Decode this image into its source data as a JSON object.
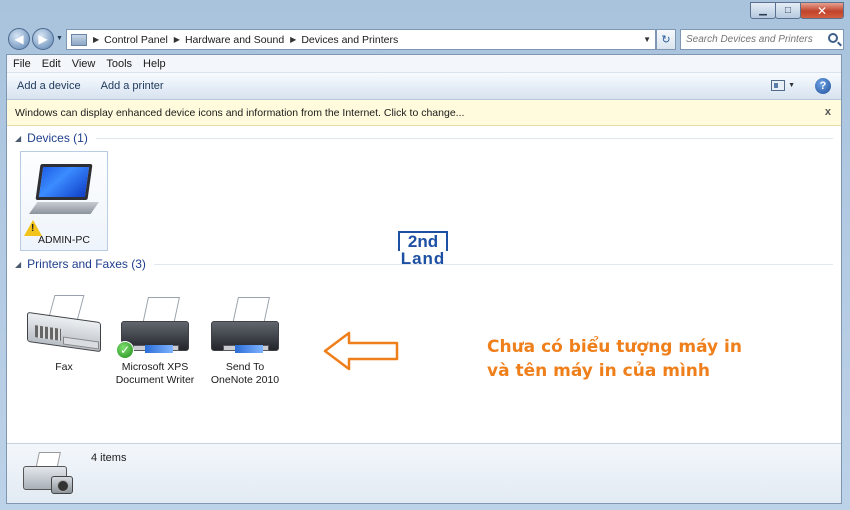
{
  "window": {
    "caption_buttons": {
      "minimize": "▁",
      "maximize": "□",
      "close": "✕"
    }
  },
  "address": {
    "back_glyph": "◀",
    "forward_glyph": "▶",
    "breadcrumbs": [
      "Control Panel",
      "Hardware and Sound",
      "Devices and Printers"
    ],
    "refresh_glyph": "↻",
    "search_placeholder": "Search Devices and Printers"
  },
  "menu": [
    "File",
    "Edit",
    "View",
    "Tools",
    "Help"
  ],
  "toolbar": {
    "add_device": "Add a device",
    "add_printer": "Add a printer",
    "help_glyph": "?"
  },
  "infobar": {
    "message": "Windows can display enhanced device icons and information from the Internet. Click to change...",
    "close_glyph": "x"
  },
  "groups": {
    "devices": {
      "label": "Devices (1)",
      "items": [
        {
          "name": "ADMIN-PC",
          "icon": "laptop-icon"
        }
      ]
    },
    "printers": {
      "label": "Printers and Faxes (3)",
      "items": [
        {
          "name": "Fax",
          "icon": "fax-icon"
        },
        {
          "name_line1": "Microsoft XPS",
          "name_line2": "Document Writer",
          "icon": "printer-icon",
          "default": true
        },
        {
          "name_line1": "Send To",
          "name_line2": "OneNote 2010",
          "icon": "printer-icon"
        }
      ]
    }
  },
  "watermark": {
    "line1": "2nd",
    "line2": "Land"
  },
  "annotation": {
    "line1": "Chưa có biểu tượng máy in",
    "line2": "và tên máy in của mình",
    "color": "#ef7f1a"
  },
  "status": {
    "count": "4 items"
  },
  "colors": {
    "accent": "#1e3f8c",
    "infobar": "#fffbdc"
  }
}
